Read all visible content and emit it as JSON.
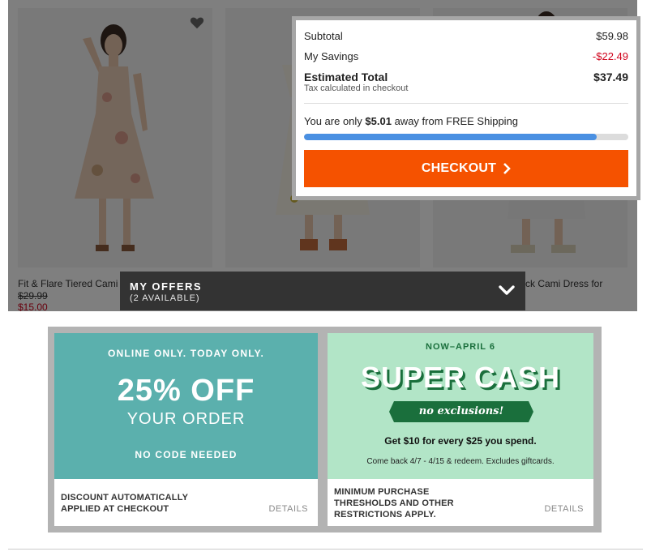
{
  "products": [
    {
      "name": "Fit & Flare Tiered Cami",
      "price_original": "$29.99",
      "price_sale": "$15.00",
      "dress_color": "#e9cdb7"
    },
    {
      "name": "",
      "dress_color": "#f4f0e4"
    },
    {
      "name": "ck Cami Dress for",
      "dress_color": "#eeeeee"
    }
  ],
  "cart": {
    "subtotal_label": "Subtotal",
    "subtotal_value": "$59.98",
    "savings_label": "My Savings",
    "savings_value": "-$22.49",
    "total_label": "Estimated Total",
    "total_value": "$37.49",
    "tax_note": "Tax calculated in checkout",
    "shipping_prefix": "You are only ",
    "shipping_amount": "$5.01",
    "shipping_suffix": " away from FREE Shipping",
    "shipping_progress": 0.902,
    "checkout_label": "CHECKOUT"
  },
  "offers_bar": {
    "title": "MY OFFERS",
    "count": "(2 AVAILABLE)"
  },
  "offers": [
    {
      "top_note": "ONLINE ONLY. TODAY ONLY.",
      "headline": "25% OFF",
      "subheadline": "YOUR ORDER",
      "code_note": "NO CODE NEEDED",
      "terms_line1": "DISCOUNT AUTOMATICALLY",
      "terms_line2": "APPLIED AT CHECKOUT",
      "details_label": "DETAILS",
      "bg_color": "#5bb0ad"
    },
    {
      "dates": "NOW–APRIL 6",
      "headline": "SUPER CASH",
      "banner": "no exclusions!",
      "get_line": "Get $10 for every $25 you spend.",
      "comeback": "Come back 4/7 - 4/15 & redeem. Excludes giftcards.",
      "terms_line1": "MINIMUM PURCHASE",
      "terms_line2": "THRESHOLDS AND OTHER",
      "terms_line3": "RESTRICTIONS APPLY.",
      "details_label": "DETAILS",
      "bg_color": "#b2e5c7"
    }
  ],
  "colors": {
    "checkout": "#f55200",
    "progress": "#4a90e2",
    "savings": "#d0021b",
    "offers_bar": "#333333"
  },
  "icons": [
    "heart-icon",
    "chevron-right-icon",
    "chevron-down-icon"
  ]
}
